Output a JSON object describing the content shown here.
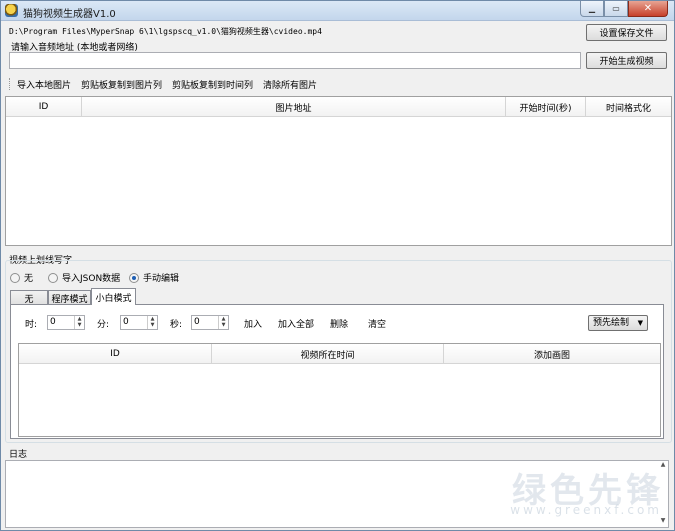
{
  "window": {
    "title": "猫狗视频生成器V1.0",
    "min_glyph": "▁",
    "max_glyph": "▭",
    "close_glyph": "✕"
  },
  "top": {
    "path": "D:\\Program Files\\MyperSnap 6\\1\\lgspscq_v1.0\\猫狗视频生器\\cvideo.mp4",
    "audio_label": "请输入音频地址 (本地或者网络)",
    "audio_value": "",
    "save_button": "设置保存文件",
    "generate_button": "开始生成视频"
  },
  "toolbar": {
    "items": [
      "导入本地图片",
      "剪贴板复制到图片列",
      "剪贴板复制到时间列",
      "清除所有图片"
    ]
  },
  "image_table": {
    "columns": [
      "ID",
      "图片地址",
      "开始时间(秒)",
      "时间格式化"
    ]
  },
  "overlay": {
    "group_label": "视频上划线写字",
    "radios": [
      {
        "label": "无",
        "selected": false
      },
      {
        "label": "导入JSON数据",
        "selected": false
      },
      {
        "label": "手动编辑",
        "selected": true
      }
    ],
    "tabs": [
      {
        "label": "无",
        "active": false
      },
      {
        "label": "程序模式",
        "active": false
      },
      {
        "label": "小白模式",
        "active": true
      }
    ],
    "time": {
      "hour_label": "时:",
      "hour_value": "0",
      "min_label": "分:",
      "min_value": "0",
      "sec_label": "秒:",
      "sec_value": "0"
    },
    "actions": [
      "加入",
      "加入全部",
      "删除",
      "清空"
    ],
    "dropdown_value": "预先绘制",
    "table_columns": [
      "ID",
      "视频所在时间",
      "添加画图"
    ]
  },
  "log": {
    "label": "日志",
    "content": ""
  },
  "watermark": {
    "text": "绿色先锋",
    "sub": "www.greenxf.com"
  },
  "colors": {
    "titlebar": "#c3d6ec",
    "window_bg": "#f0f0f0",
    "radio_selected": "#1e5fb4"
  }
}
